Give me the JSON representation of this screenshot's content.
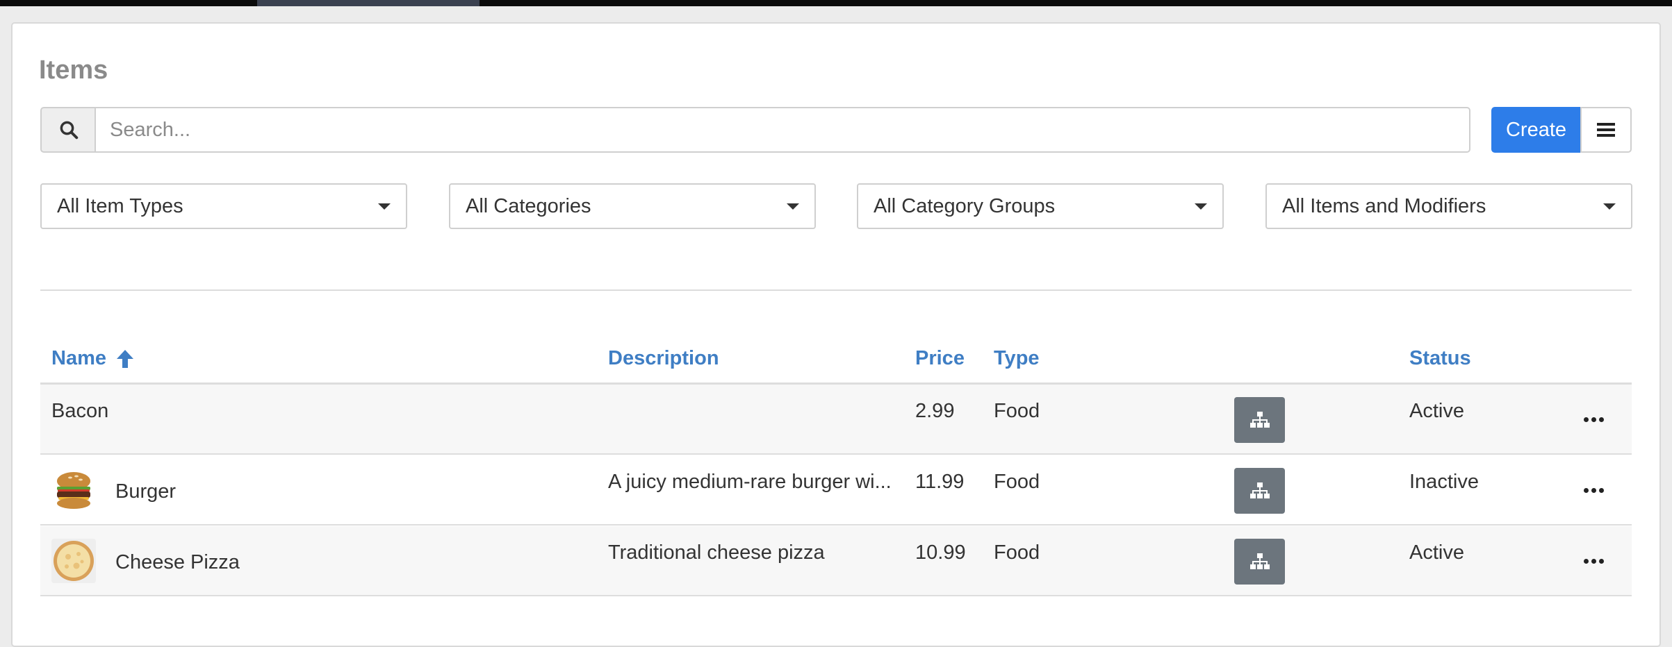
{
  "page": {
    "title": "Items"
  },
  "search": {
    "placeholder": "Search..."
  },
  "toolbar": {
    "create_label": "Create"
  },
  "filters": [
    {
      "label": "All Item Types"
    },
    {
      "label": "All Categories"
    },
    {
      "label": "All Category Groups"
    },
    {
      "label": "All Items and Modifiers"
    }
  ],
  "table": {
    "columns": {
      "name": "Name",
      "description": "Description",
      "price": "Price",
      "type": "Type",
      "status": "Status"
    },
    "sort": {
      "column": "name",
      "direction": "ascending",
      "icon": "arrow-up-icon"
    },
    "rows": [
      {
        "name": "Bacon",
        "description": "",
        "price": "2.99",
        "type": "Food",
        "status": "Active",
        "image": "none"
      },
      {
        "name": "Burger",
        "description": "A juicy medium-rare burger wi...",
        "price": "11.99",
        "type": "Food",
        "status": "Inactive",
        "image": "burger-thumbnail"
      },
      {
        "name": "Cheese Pizza",
        "description": "Traditional cheese pizza",
        "price": "10.99",
        "type": "Food",
        "status": "Active",
        "image": "pizza-thumbnail"
      }
    ]
  },
  "icons": {
    "search": "search-icon",
    "menu": "hamburger-menu-icon",
    "modifiers": "sitemap-icon",
    "more": "ellipsis-icon"
  },
  "colors": {
    "accent": "#2d7de9",
    "header_text": "#3f7ec4",
    "modifier_button": "#6c757d"
  }
}
